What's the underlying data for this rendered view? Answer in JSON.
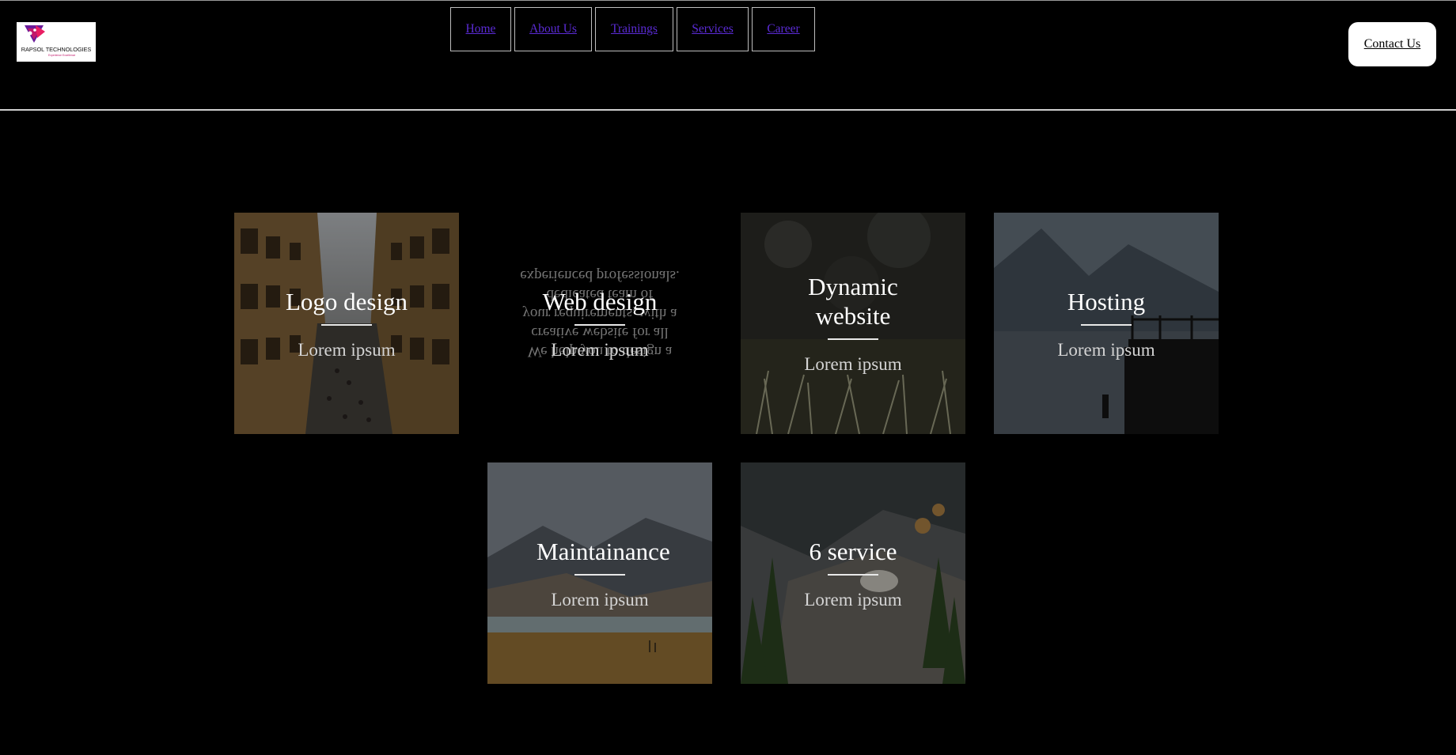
{
  "header": {
    "logo": {
      "name": "RAPSOL TECHNOLOGIES",
      "tagline": "Experience Excellence",
      "colors": {
        "primary": "#c2186b",
        "secondary": "#6a1b9a"
      }
    },
    "nav": [
      {
        "label": "Home"
      },
      {
        "label": "About Us"
      },
      {
        "label": "Trainings"
      },
      {
        "label": "Services"
      },
      {
        "label": "Career"
      }
    ],
    "contact_label": "Contact Us",
    "link_color": "#5b2bd6"
  },
  "services": [
    {
      "title": "Logo design",
      "subtitle": "Lorem ipsum"
    },
    {
      "title": "Web design",
      "subtitle": "Lorem ipsum",
      "hover_text": "We help you to design a creative website for all your requirements, with a dedicated team of experienced professionals."
    },
    {
      "title": "Dynamic website",
      "subtitle": "Lorem ipsum"
    },
    {
      "title": "Hosting",
      "subtitle": "Lorem ipsum"
    },
    {
      "title": "Maintainance",
      "subtitle": "Lorem ipsum"
    },
    {
      "title": "6 service",
      "subtitle": "Lorem ipsum"
    }
  ],
  "colors": {
    "background": "#000000",
    "text": "#ffffff",
    "subtext": "#d4d4d4"
  }
}
